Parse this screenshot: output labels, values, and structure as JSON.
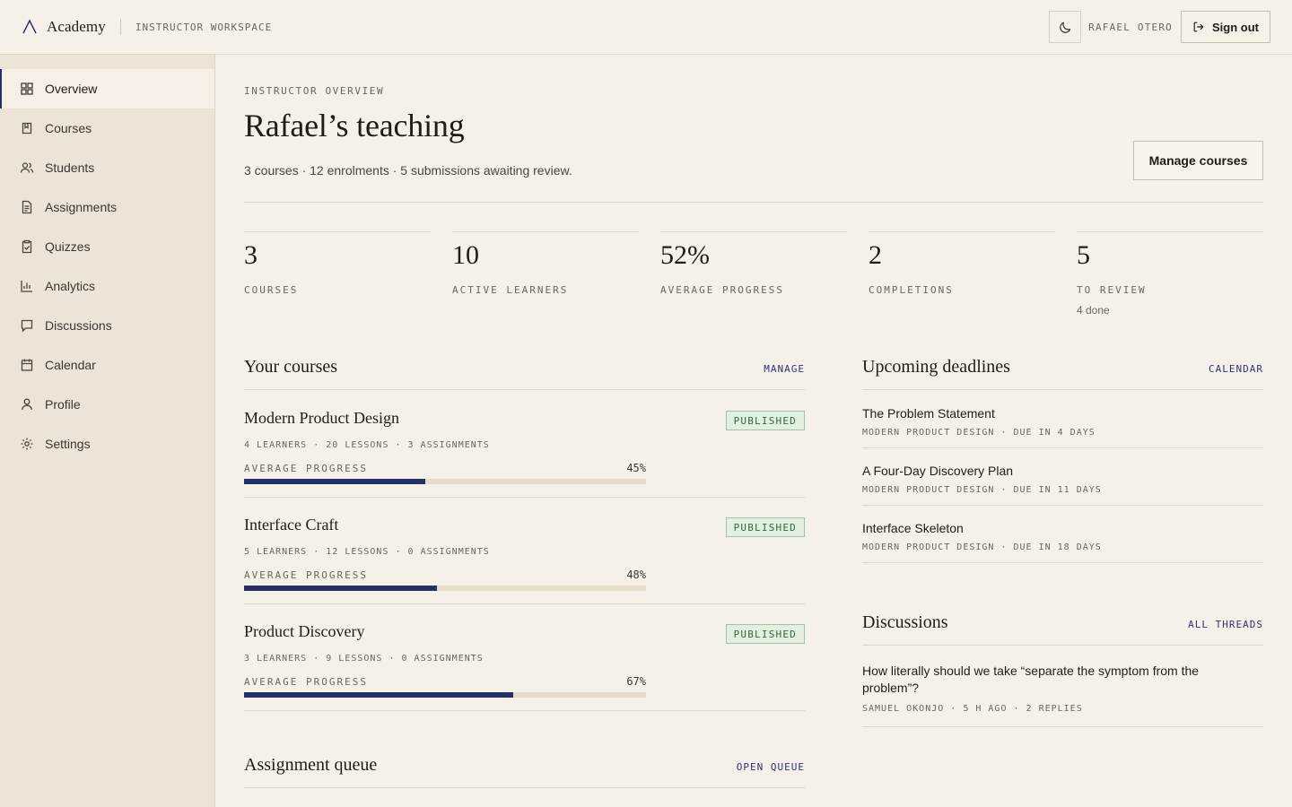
{
  "app": {
    "brand": "Academy",
    "workspace": "INSTRUCTOR WORKSPACE",
    "user_name": "RAFAEL OTERO",
    "sign_out": "Sign out",
    "accent_color": "#25306b"
  },
  "sidebar": {
    "items": [
      {
        "label": "Overview",
        "icon": "grid-icon",
        "active": true
      },
      {
        "label": "Courses",
        "icon": "book-icon"
      },
      {
        "label": "Students",
        "icon": "users-icon"
      },
      {
        "label": "Assignments",
        "icon": "document-icon"
      },
      {
        "label": "Quizzes",
        "icon": "clipboard-check-icon"
      },
      {
        "label": "Analytics",
        "icon": "bar-chart-icon"
      },
      {
        "label": "Discussions",
        "icon": "chat-icon"
      },
      {
        "label": "Calendar",
        "icon": "calendar-icon"
      },
      {
        "label": "Profile",
        "icon": "user-icon"
      },
      {
        "label": "Settings",
        "icon": "gear-icon"
      }
    ]
  },
  "header": {
    "eyebrow": "INSTRUCTOR OVERVIEW",
    "title": "Rafael’s teaching",
    "subtitle": "3 courses · 12 enrolments · 5 submissions awaiting review.",
    "manage_button": "Manage courses"
  },
  "stats": [
    {
      "value": "3",
      "label": "COURSES"
    },
    {
      "value": "10",
      "label": "ACTIVE LEARNERS"
    },
    {
      "value": "52%",
      "label": "AVERAGE PROGRESS"
    },
    {
      "value": "2",
      "label": "COMPLETIONS"
    },
    {
      "value": "5",
      "label": "TO REVIEW",
      "note": "4 done"
    }
  ],
  "courses_section": {
    "title": "Your courses",
    "link": "MANAGE",
    "progress_label": "AVERAGE PROGRESS",
    "items": [
      {
        "name": "Modern Product Design",
        "status": "PUBLISHED",
        "meta": "4 LEARNERS · 20 LESSONS · 3 ASSIGNMENTS",
        "progress": 45,
        "progress_text": "45%"
      },
      {
        "name": "Interface Craft",
        "status": "PUBLISHED",
        "meta": "5 LEARNERS · 12 LESSONS · 0 ASSIGNMENTS",
        "progress": 48,
        "progress_text": "48%"
      },
      {
        "name": "Product Discovery",
        "status": "PUBLISHED",
        "meta": "3 LEARNERS · 9 LESSONS · 0 ASSIGNMENTS",
        "progress": 67,
        "progress_text": "67%"
      }
    ]
  },
  "assignment_queue": {
    "title": "Assignment queue",
    "link": "OPEN QUEUE"
  },
  "deadlines": {
    "title": "Upcoming deadlines",
    "link": "CALENDAR",
    "items": [
      {
        "title": "The Problem Statement",
        "meta": "MODERN PRODUCT DESIGN · DUE IN 4 DAYS"
      },
      {
        "title": "A Four-Day Discovery Plan",
        "meta": "MODERN PRODUCT DESIGN · DUE IN 11 DAYS"
      },
      {
        "title": "Interface Skeleton",
        "meta": "MODERN PRODUCT DESIGN · DUE IN 18 DAYS"
      }
    ]
  },
  "discussions": {
    "title": "Discussions",
    "link": "ALL THREADS",
    "items": [
      {
        "question": "How literally should we take “separate the symptom from the problem”?",
        "meta": "SAMUEL OKONJO · 5 H AGO · 2 REPLIES"
      }
    ]
  }
}
